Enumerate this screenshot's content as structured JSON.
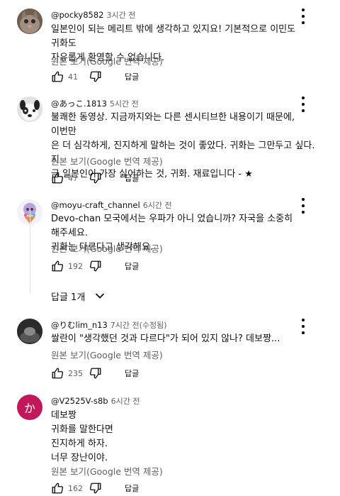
{
  "ui": {
    "translate_label": "원본 보기(Google 번역 제공)",
    "reply_label": "답글"
  },
  "comments": [
    {
      "author": "@pocky8582",
      "time": "3시간 전",
      "lines": [
        "일본인이 되는 메리트 밖에 생각하고 있지요! 기본적으로 이민도 귀화도",
        "자유롭게 환영할 수 없습니다."
      ],
      "likes": "41",
      "avatar": {
        "kind": "cat",
        "color": "#7a6a5c"
      }
    },
    {
      "author": "@あっこ.1813",
      "time": "5시간 전",
      "lines": [
        "불쾌한 동영상. 지금까지와는 다른 센시티브한 내용이기 때문에, 이번만",
        "은 더 심각하게, 진지하게 말하는 것이 좋았다. 귀화는 그만두고 싶다. 지",
        "금 일본인이 가장 싫어하는 것, 귀화. 재료입니다 - ★"
      ],
      "likes": "47",
      "avatar": {
        "kind": "dog",
        "color": "#cfcfcf"
      }
    },
    {
      "author": "@moyu-craft_channel",
      "time": "6시간 전",
      "lines": [
        "Devo-chan 모국에서는 우파가 아니 었습니까? 자국을 소중히 해주세요.",
        "귀화는 다르다고 생각해요."
      ],
      "likes": "192",
      "avatar": {
        "kind": "char",
        "color": "#e8e0f0"
      }
    },
    {
      "author": "@りむlim_n13",
      "time": "7시간 전(수정됨)",
      "lines": [
        "쌀란이 \"생각했던 것과 다르다\"가 되어 있지 않나? 데보짱..."
      ],
      "likes": "235",
      "avatar": {
        "kind": "dark",
        "color": "#3a3a3a"
      }
    },
    {
      "author": "@V2525V-s8b",
      "time": "6시간 전",
      "lines": [
        "데보짱",
        "귀화를 말한다면",
        "진지하게 하자.",
        "너무 장난이야."
      ],
      "likes": "162",
      "avatar": {
        "kind": "letter",
        "letter": "か",
        "color": "#c2185b"
      }
    }
  ],
  "replies_toggle": {
    "label": "답글 1개"
  }
}
